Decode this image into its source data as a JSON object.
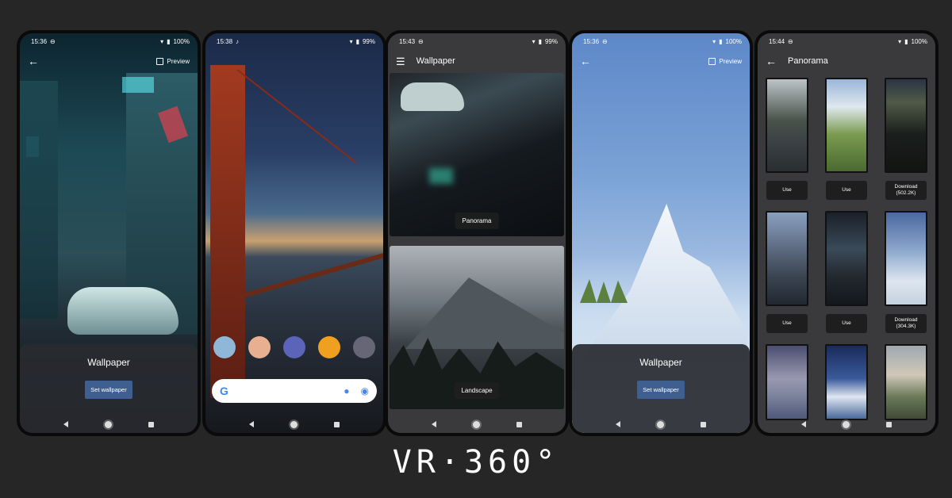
{
  "caption": "VR·360°",
  "phone1": {
    "status": {
      "time": "15:36",
      "battery": "100%"
    },
    "preview_label": "Preview",
    "panel_title": "Wallpaper",
    "set_button": "Set wallpaper"
  },
  "phone2": {
    "status": {
      "time": "15:38",
      "battery": "99%"
    },
    "dock_icons": [
      "weather-app-icon",
      "pig-app-icon",
      "game-app-icon",
      "calculator-app-icon",
      "storm-app-icon"
    ]
  },
  "phone3": {
    "status": {
      "time": "15:43",
      "battery": "99%"
    },
    "title": "Wallpaper",
    "tiles": [
      {
        "label": "Panorama"
      },
      {
        "label": "Landscape"
      }
    ]
  },
  "phone4": {
    "status": {
      "time": "15:36",
      "battery": "100%"
    },
    "preview_label": "Preview",
    "panel_title": "Wallpaper",
    "set_button": "Set wallpaper"
  },
  "phone5": {
    "status": {
      "time": "15:44",
      "battery": "100%"
    },
    "title": "Panorama",
    "items": [
      {
        "button": "Use"
      },
      {
        "button": "Use"
      },
      {
        "button": "Download\n(502.2K)"
      },
      {
        "button": "Use"
      },
      {
        "button": "Use"
      },
      {
        "button": "Download\n(304.3K)"
      },
      {
        "button": ""
      },
      {
        "button": ""
      },
      {
        "button": ""
      }
    ]
  },
  "colors": {
    "background": "#262626",
    "button_blue": "#3e5f8f",
    "dark_panel": "#28282e"
  }
}
